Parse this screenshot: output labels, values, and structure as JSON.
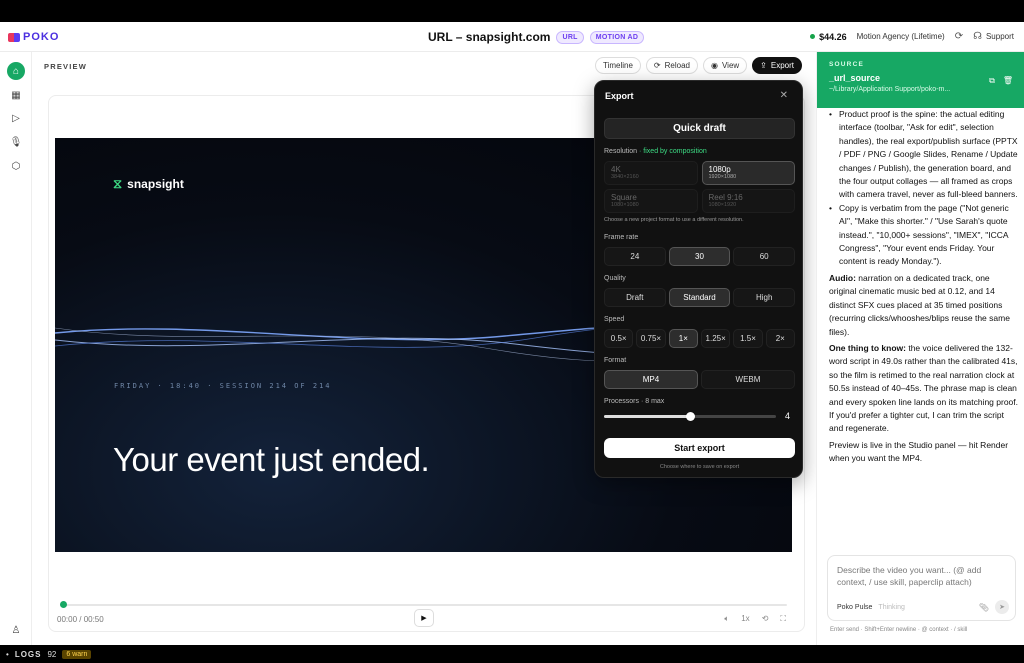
{
  "app": {
    "logo": "POKO"
  },
  "header": {
    "title": "URL – snapsight.com",
    "badges": [
      "URL",
      "MOTION AD"
    ],
    "balance": "$44.26",
    "plan": "Motion Agency (Lifetime)",
    "support": "Support"
  },
  "preview": {
    "label": "PREVIEW",
    "toolbar": {
      "timeline": "Timeline",
      "reload": "Reload",
      "view": "View",
      "export": "Export"
    },
    "video": {
      "brand": "snapsight",
      "meta": "FRIDAY · 18:40 · SESSION 214 OF 214",
      "headline": "Your event just ended."
    },
    "player": {
      "timecode": "00:00 / 00:50",
      "speed": "1x",
      "progress": 0
    }
  },
  "export_modal": {
    "title": "Export",
    "quick": "Quick draft",
    "resolution_label": "Resolution",
    "resolution_fixed": "· fixed by composition",
    "resolutions": [
      {
        "name": "4K",
        "dims": "3840×2160"
      },
      {
        "name": "1080p",
        "dims": "1920×1080"
      },
      {
        "name": "Square",
        "dims": "1080×1080"
      },
      {
        "name": "Reel 9:16",
        "dims": "1080×1920"
      }
    ],
    "resolution_selected": 1,
    "resolution_hint": "Choose a new project format to use a different resolution.",
    "frame_rate_label": "Frame rate",
    "frame_rates": [
      "24",
      "30",
      "60"
    ],
    "frame_rate_selected": 1,
    "quality_label": "Quality",
    "qualities": [
      "Draft",
      "Standard",
      "High"
    ],
    "quality_selected": 1,
    "speed_label": "Speed",
    "speeds": [
      "0.5×",
      "0.75×",
      "1×",
      "1.25×",
      "1.5×",
      "2×"
    ],
    "speed_selected": 2,
    "format_label": "Format",
    "formats": [
      "MP4",
      "WEBM"
    ],
    "format_selected": 0,
    "processors_label": "Processors · 8 max",
    "processors_value": "4",
    "processors_fraction": 0.5,
    "start": "Start export",
    "start_hint": "Choose where to save on export"
  },
  "right_panel": {
    "source_key": "SOURCE",
    "source_name": "_url_source",
    "source_path": "~/Library/Application Support/poko-m...",
    "bullets": [
      "Product proof is the spine: the actual editing interface (toolbar, \"Ask for edit\", selection handles), the real export/publish surface (PPTX / PDF / PNG / Google Slides, Rename / Update changes / Publish), the generation board, and the four output collages — all framed as crops with camera travel, never as full-bleed banners.",
      "Copy is verbatim from the page (\"Not generic AI\", \"Make this shorter.\" / \"Use Sarah's quote instead.\", \"10,000+ sessions\", \"IMEX\", \"ICCA Congress\", \"Your event ends Friday. Your content is ready Monday.\")."
    ],
    "audio_label": "Audio:",
    "audio_text": "narration on a dedicated track, one original cinematic music bed at 0.12, and 14 distinct SFX cues placed at 35 timed positions (recurring clicks/whooshes/blips reuse the same files).",
    "know_label": "One thing to know:",
    "know_text": "the voice delivered the 132-word script in 49.0s rather than the calibrated 41s, so the film is retimed to the real narration clock at 50.5s instead of 40–45s. The phrase map is clean and every spoken line lands on its matching proof. If you'd prefer a tighter cut, I can trim the script and regenerate.",
    "closing": "Preview is live in the Studio panel — hit Render when you want the MP4.",
    "chat_placeholder": "Describe the video you want... (@ add context, / use skill, paperclip attach)",
    "chat_model": "Poko Pulse",
    "chat_thinking": "Thinking",
    "chat_hint": "Enter send · Shift+Enter newline · @ context · / skill"
  },
  "logs": {
    "label": "LOGS",
    "count": "92",
    "warn": "6 warn"
  },
  "colors": {
    "accent": "#17a864",
    "brand": "#4b2fe0",
    "modal_bg": "#111111"
  }
}
